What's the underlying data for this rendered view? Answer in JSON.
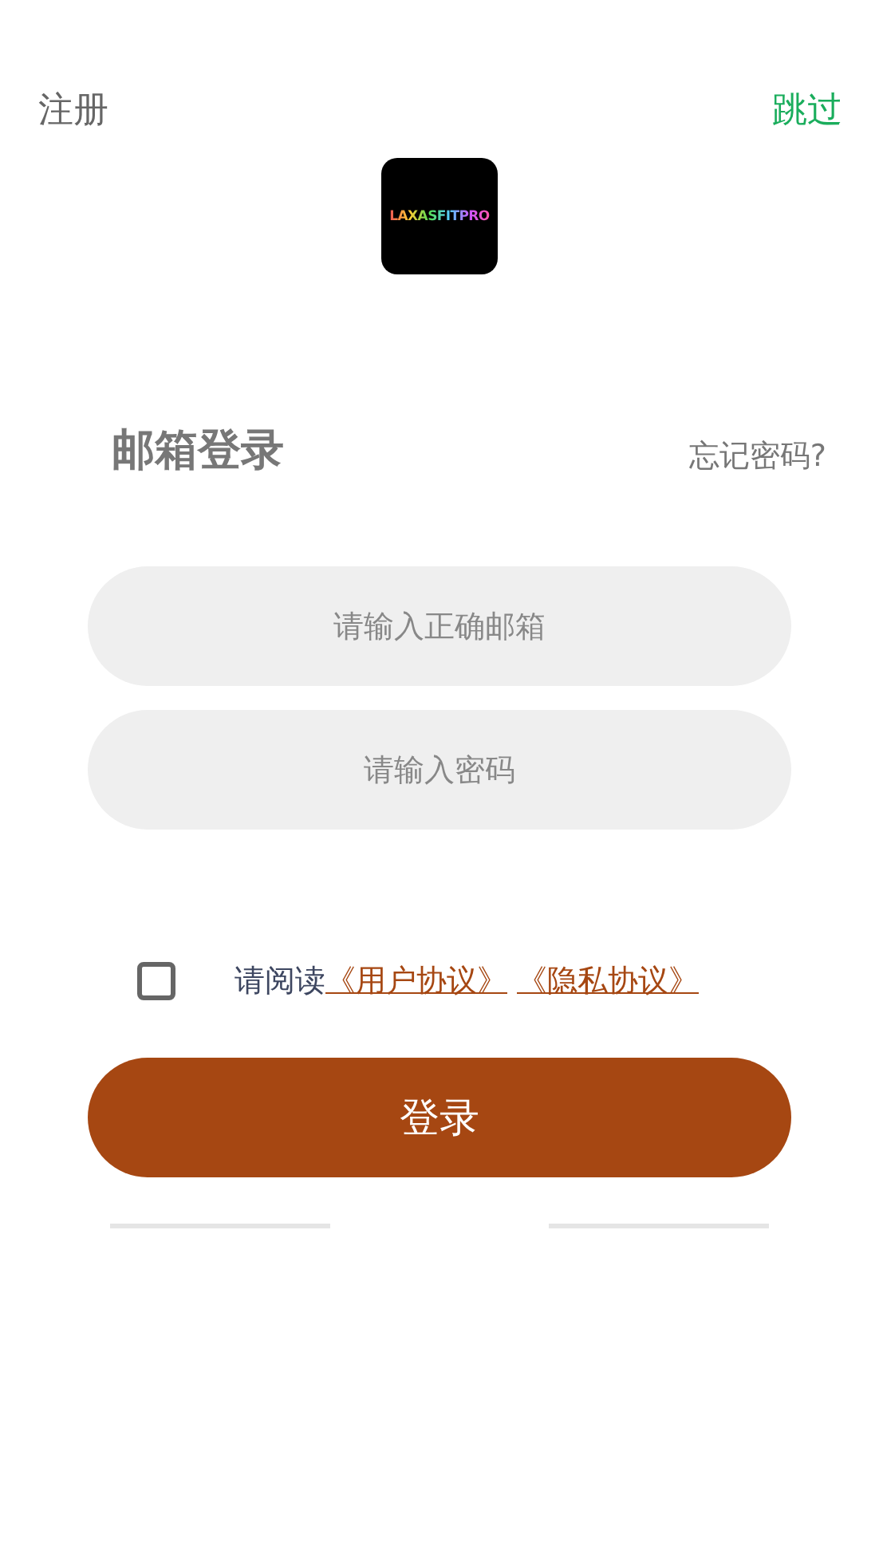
{
  "top_bar": {
    "register": "注册",
    "skip": "跳过"
  },
  "logo": {
    "text": "LAXASFITPRO"
  },
  "heading": {
    "title": "邮箱登录",
    "forgot": "忘记密码?"
  },
  "fields": [
    {
      "placeholder": "请输入正确邮箱"
    },
    {
      "placeholder": "请输入密码"
    }
  ],
  "agreement": {
    "checked": false,
    "prefix": "请阅读",
    "links": [
      "《用户协议》",
      "《隐私协议》"
    ]
  },
  "login_button": "登录"
}
